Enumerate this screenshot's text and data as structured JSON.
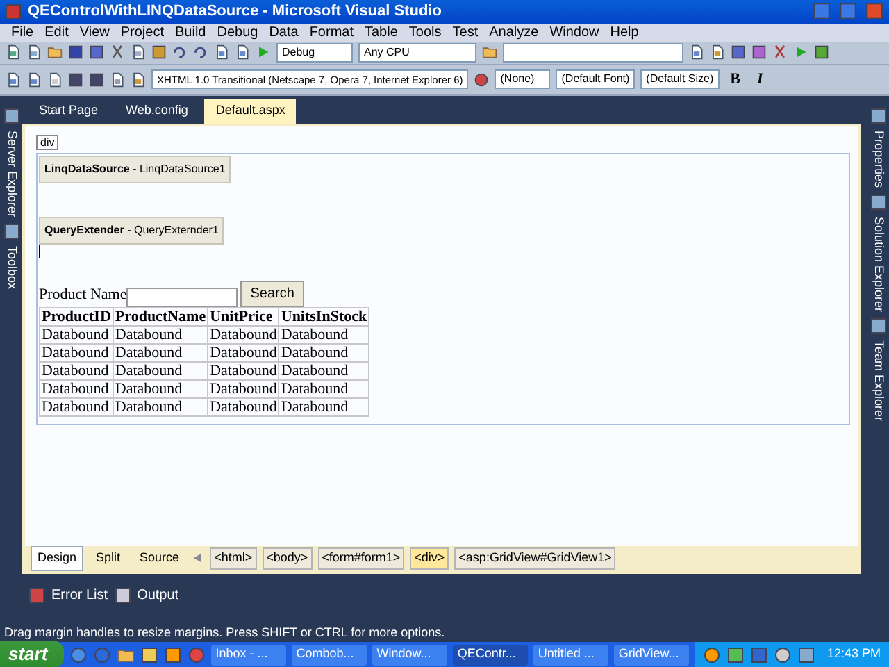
{
  "window": {
    "title": "QEControlWithLINQDataSource - Microsoft Visual Studio"
  },
  "menu": [
    "File",
    "Edit",
    "View",
    "Project",
    "Build",
    "Debug",
    "Data",
    "Format",
    "Table",
    "Tools",
    "Test",
    "Analyze",
    "Window",
    "Help"
  ],
  "toolbar_1": {
    "configuration": "Debug",
    "platform": "Any CPU"
  },
  "toolbar_2": {
    "doctype": "XHTML 1.0 Transitional (Netscape 7, Opera 7, Internet Explorer 6)",
    "style": "(None)",
    "font": "(Default Font)",
    "size": "(Default Size)",
    "bold": "B",
    "italic": "I"
  },
  "left_dock": [
    "Server Explorer",
    "Toolbox"
  ],
  "right_dock": [
    "Properties",
    "Solution Explorer",
    "Team Explorer"
  ],
  "tabs": [
    {
      "label": "Start Page",
      "selected": false
    },
    {
      "label": "Web.config",
      "selected": false
    },
    {
      "label": "Default.aspx",
      "selected": true
    }
  ],
  "design": {
    "tag": "div",
    "controls": [
      {
        "label": "**LinqDataSource** - LinqDataSource1"
      },
      {
        "label": "**QueryExtender** - QueryExternder1"
      }
    ],
    "search_label": "Product Name",
    "search_button": "Search",
    "grid": {
      "columns": [
        "ProductID",
        "ProductName",
        "UnitPrice",
        "UnitsInStock"
      ],
      "rows": [
        [
          "Databound",
          "Databound",
          "Databound",
          "Databound"
        ],
        [
          "Databound",
          "Databound",
          "Databound",
          "Databound"
        ],
        [
          "Databound",
          "Databound",
          "Databound",
          "Databound"
        ],
        [
          "Databound",
          "Databound",
          "Databound",
          "Databound"
        ],
        [
          "Databound",
          "Databound",
          "Databound",
          "Databound"
        ]
      ]
    }
  },
  "view_tabs": [
    {
      "label": "Design",
      "selected": true
    },
    {
      "label": "Split",
      "selected": false
    },
    {
      "label": "Source",
      "selected": false
    }
  ],
  "breadcrumbs": [
    {
      "label": "<html>",
      "selected": false
    },
    {
      "label": "<body>",
      "selected": false
    },
    {
      "label": "<form#form1>",
      "selected": false
    },
    {
      "label": "<div>",
      "selected": true
    },
    {
      "label": "<asp:GridView#GridView1>",
      "selected": false
    }
  ],
  "bottom_tabs": [
    "Error List",
    "Output"
  ],
  "status_bar": "Drag margin handles to resize margins. Press SHIFT or CTRL for more options.",
  "taskbar": {
    "start": "start",
    "tasks": [
      {
        "label": "Inbox - ...",
        "selected": false
      },
      {
        "label": "Combob...",
        "selected": false
      },
      {
        "label": "Window...",
        "selected": false
      },
      {
        "label": "QEContr...",
        "selected": true
      },
      {
        "label": "Untitled ...",
        "selected": false
      },
      {
        "label": "GridView...",
        "selected": false
      }
    ],
    "clock": "12:43 PM"
  }
}
